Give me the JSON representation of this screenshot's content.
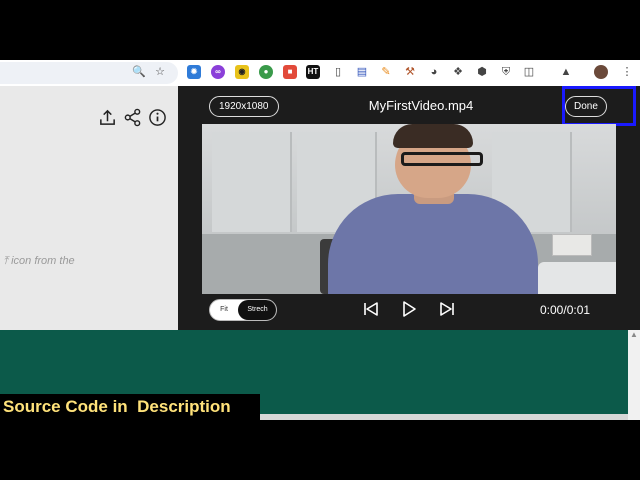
{
  "browser": {
    "toolbar_icons": [
      "zoom-icon",
      "star-icon",
      "extension-icons",
      "puzzle-icon",
      "profile-avatar",
      "menu-kebab-icon"
    ],
    "ext_labels": {
      "ht": "HT"
    }
  },
  "left_panel": {
    "hint_text": "e ⤒ icon from the\nl.",
    "icons": [
      "upload-icon",
      "share-icon",
      "info-icon"
    ]
  },
  "modal": {
    "resolution": "1920x1080",
    "file_name": "MyFirstVideo.mp4",
    "done_label": "Done",
    "fit_label": "Fit",
    "stretch_label": "Strech",
    "timecode": "0:00/0:01"
  },
  "caption": "Source Code in  Description",
  "colors": {
    "modal_bg": "#1c1c1c",
    "green_bg": "#0c5a4a",
    "caption_text": "#ffe27a",
    "highlight": "#1a1aff"
  }
}
